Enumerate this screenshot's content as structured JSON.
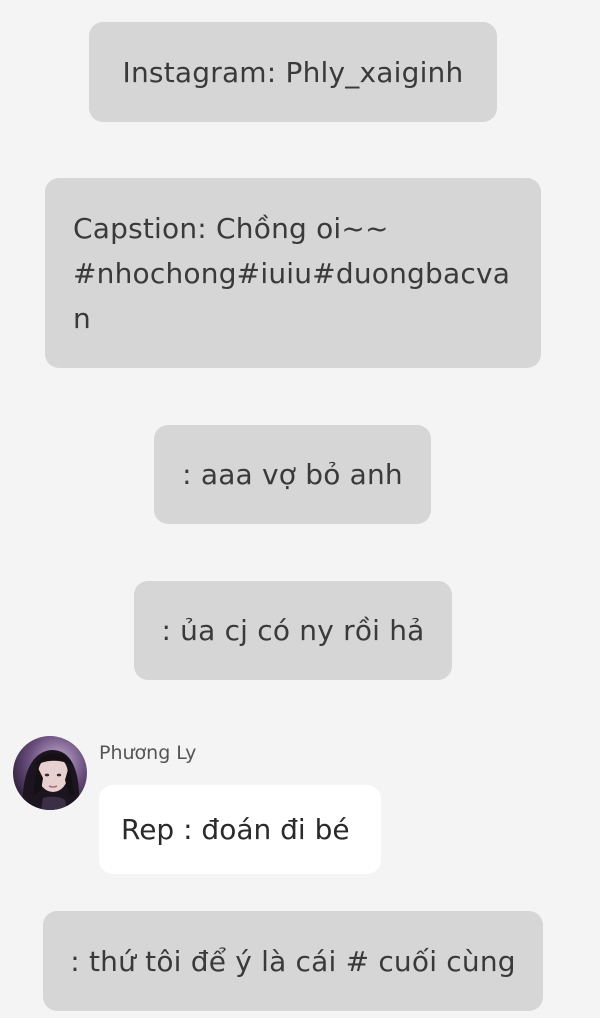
{
  "messages": [
    {
      "text": "Instagram: Phly_xaiginh"
    },
    {
      "lines": [
        "Capstion: Chồng oi~~",
        "#nhochong#iuiu#duongbacva",
        "n"
      ]
    },
    {
      "text": ": aaa vợ bỏ anh"
    },
    {
      "text": ": ủa cj có ny rồi hả"
    }
  ],
  "reply": {
    "sender": "Phương Ly",
    "text": "Rep : đoán đi bé"
  },
  "last_message": {
    "text": ": thứ tôi để ý là cái # cuối cùng"
  },
  "colors": {
    "background": "#f4f4f4",
    "bubble": "#d6d6d6",
    "reply_bubble": "#ffffff",
    "text": "#3a3a3a"
  }
}
